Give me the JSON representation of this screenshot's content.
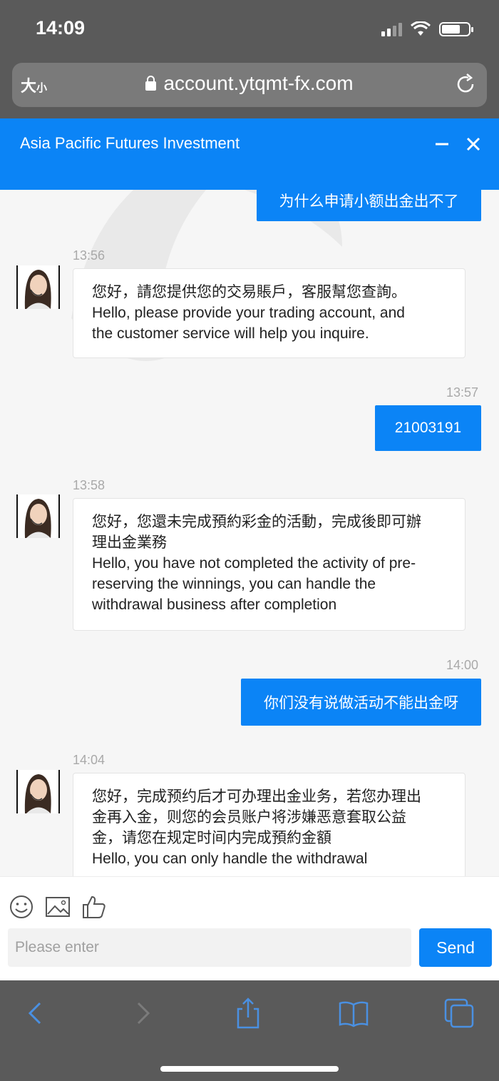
{
  "status_bar": {
    "time": "14:09"
  },
  "browser": {
    "text_size_label_big": "大",
    "text_size_label_small": "小",
    "url": "account.ytqmt-fx.com"
  },
  "chat": {
    "title": "Asia Pacific Futures Investment",
    "messages": [
      {
        "type": "out",
        "text": "为什么申请小额出金出不了"
      },
      {
        "type": "in",
        "time": "13:56",
        "lines": [
          "您好，請您提供您的交易賬戶，客服幫您查詢。",
          "Hello, please provide your trading account, and",
          "the customer service will help you inquire."
        ]
      },
      {
        "type": "out",
        "time": "13:57",
        "text": "21003191"
      },
      {
        "type": "in",
        "time": "13:58",
        "lines": [
          "您好，您還未完成預約彩金的活動，完成後即可辦",
          "理出金業務",
          "Hello, you have not completed the activity of pre-",
          "reserving the winnings, you can handle the",
          "withdrawal business after completion"
        ]
      },
      {
        "type": "out",
        "time": "14:00",
        "text": "你们没有说做活动不能出金呀"
      },
      {
        "type": "in",
        "time": "14:04",
        "lines": [
          "您好，完成预约后才可办理出金业务，若您办理出",
          "金再入金，则您的会员账户将涉嫌恶意套取公益",
          "金，请您在规定时间内完成預約金額",
          "Hello, you can only handle the withdrawal"
        ]
      }
    ]
  },
  "composer": {
    "placeholder": "Please enter",
    "send_label": "Send"
  },
  "colors": {
    "accent": "#0b84f6",
    "chrome": "#5a5a5a"
  }
}
